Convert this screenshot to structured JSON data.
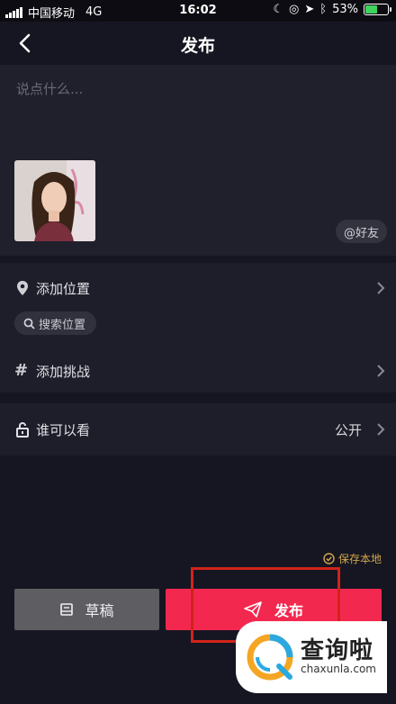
{
  "status_bar": {
    "carrier": "中国移动",
    "network": "4G",
    "time": "16:02",
    "battery_percent": "53%",
    "battery_level": 0.53
  },
  "nav": {
    "title": "发布",
    "back_icon": "chevron-left-icon"
  },
  "caption": {
    "placeholder": "说点什么...",
    "mention_label": "@好友"
  },
  "location": {
    "label": "添加位置",
    "search_chip": "搜索位置"
  },
  "challenge": {
    "label": "添加挑战"
  },
  "privacy": {
    "label": "谁可以看",
    "value": "公开"
  },
  "save_local": {
    "label": "保存本地",
    "checked": true
  },
  "actions": {
    "draft_label": "草稿",
    "publish_label": "发布"
  },
  "watermark": {
    "name": "查询啦",
    "site": "chaxunla.com"
  },
  "colors": {
    "background": "#161622",
    "publish": "#f3284f",
    "draft": "#5d5d62",
    "save_local": "#d2a64a",
    "highlight": "#d2231a"
  }
}
